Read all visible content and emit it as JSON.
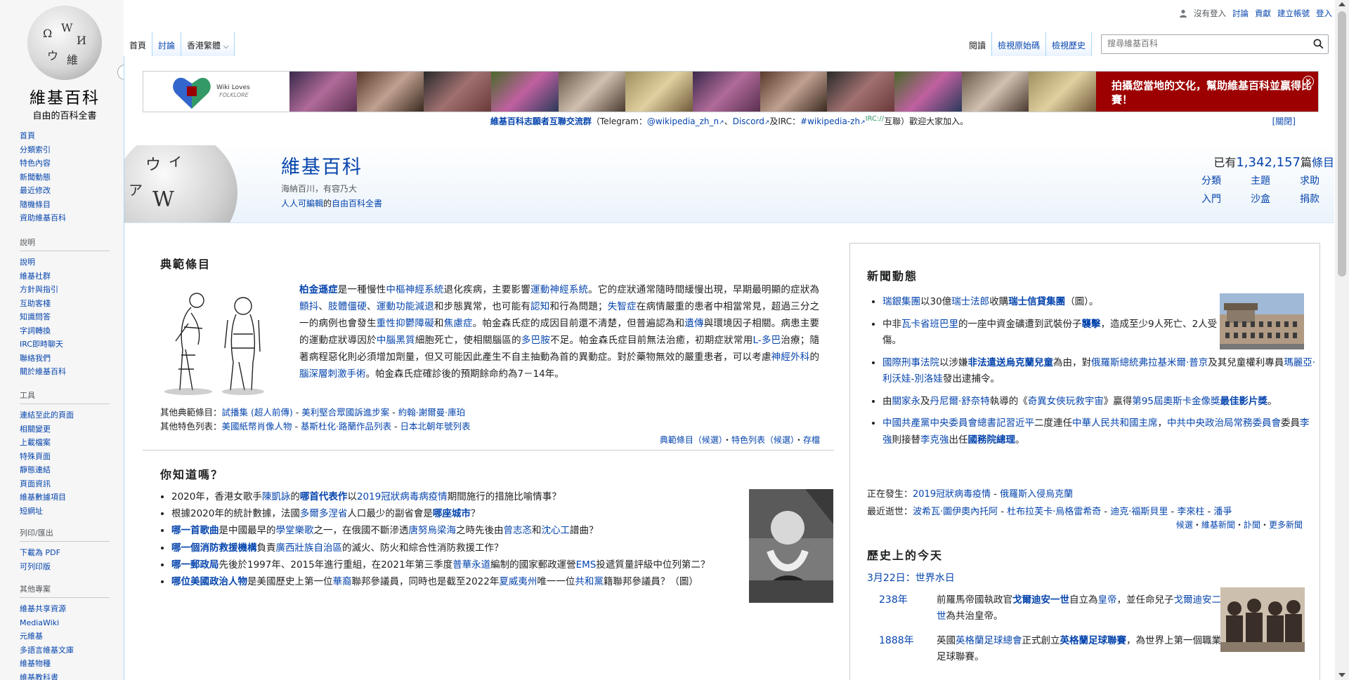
{
  "logo": {
    "wordmark": "維基百科",
    "tagline": "自由的百科全書"
  },
  "sidebar": {
    "main": [
      "首頁",
      "分類索引",
      "特色內容",
      "新聞動態",
      "最近修改",
      "隨機條目",
      "資助維基百科"
    ],
    "help_heading": "說明",
    "help": [
      "說明",
      "維基社群",
      "方針與指引",
      "互助客棧",
      "知識問答",
      "字詞轉換",
      "IRC即時聊天",
      "聯絡我們",
      "關於維基百科"
    ],
    "tools_heading": "工具",
    "tools": [
      "連結至此的頁面",
      "相關變更",
      "上載檔案",
      "特殊頁面",
      "靜態連結",
      "頁面資訊",
      "維基數據項目",
      "短網址"
    ],
    "print_heading": "列印/匯出",
    "print": [
      "下載為 PDF",
      "可列印版"
    ],
    "other_heading": "其他專案",
    "other": [
      "維基共享資源",
      "MediaWiki",
      "元維基",
      "多語言維基文庫",
      "維基物種",
      "維基教科書"
    ]
  },
  "personal": [
    "沒有登入",
    "討論",
    "貢獻",
    "建立帳號",
    "登入"
  ],
  "tabs_left": [
    "首頁",
    "討論",
    "香港繁體"
  ],
  "tabs_right": [
    "閱讀",
    "檢視原始碼",
    "檢視歷史"
  ],
  "search": {
    "placeholder": "搜尋維基百科"
  },
  "banner": {
    "wlf_line1": "Wiki Loves",
    "wlf_line2": "FOLKLORE",
    "message": "拍攝您當地的文化，幫助維基百科並贏得比賽！"
  },
  "notice": {
    "link1": "維基百科志願者互聯交流群",
    "t1": "（Telegram：",
    "link2": "@wikipedia_zh_n",
    "t2": "、",
    "link3": "Discord",
    "t3": "及IRC：",
    "link4": "#wikipedia-zh",
    "irc": "IRC://",
    "t4": "互聯）歡迎大家加入。",
    "close": "[關閉]"
  },
  "mainpage": {
    "title": "維基百科",
    "sub1": "海納百川，有容乃大",
    "sub2_link1": "人人可編輯",
    "sub2_text": "的",
    "sub2_link2": "自由百科全書",
    "count_prefix": "已有",
    "count": "1,342,157",
    "count_suffix": "篇",
    "count_link": "條目",
    "links": [
      "分類",
      "主題",
      "求助",
      "入門",
      "沙盒",
      "捐款"
    ]
  },
  "tfa": {
    "title": "典範條目",
    "text": [
      {
        "t": "柏金遜症",
        "l": 1,
        "b": 1
      },
      {
        "t": "是一種慢性"
      },
      {
        "t": "中樞神經系統",
        "l": 1
      },
      {
        "t": "退化疾病，主要影響"
      },
      {
        "t": "運動神經系統",
        "l": 1
      },
      {
        "t": "。它的症狀通常隨時間緩慢出現，早期最明顯的症狀為"
      },
      {
        "t": "顫抖",
        "l": 1
      },
      {
        "t": "、"
      },
      {
        "t": "肢體僵硬",
        "l": 1
      },
      {
        "t": "、"
      },
      {
        "t": "運動功能減退",
        "l": 1
      },
      {
        "t": "和步態異常，也可能有"
      },
      {
        "t": "認知",
        "l": 1
      },
      {
        "t": "和行為問題；"
      },
      {
        "t": "失智症",
        "l": 1
      },
      {
        "t": "在病情嚴重的患者中相當常見，超過三分之一的病例也會發生"
      },
      {
        "t": "重性抑鬱障礙",
        "l": 1
      },
      {
        "t": "和"
      },
      {
        "t": "焦慮症",
        "l": 1
      },
      {
        "t": "。帕金森氏症的成因目前還不清楚，但普遍認為和"
      },
      {
        "t": "遺傳",
        "l": 1
      },
      {
        "t": "與環境因子相關。病患主要的運動症狀導因於"
      },
      {
        "t": "中腦",
        "l": 1
      },
      {
        "t": "黑質",
        "l": 1
      },
      {
        "t": "細胞死亡，使相關腦區的"
      },
      {
        "t": "多巴胺",
        "l": 1
      },
      {
        "t": "不足。帕金森氏症目前無法治癒，初期症狀常用"
      },
      {
        "t": "L-多巴",
        "l": 1
      },
      {
        "t": "治療；隨著病程惡化則必須增加劑量，但又可能因此產生不自主抽動為首的異動症。對於藥物無效的嚴重患者，可以考慮"
      },
      {
        "t": "神經外科",
        "l": 1
      },
      {
        "t": "的"
      },
      {
        "t": "腦深層刺激手術",
        "l": 1
      },
      {
        "t": "。帕金森氏症確診後的預期餘命約為7－14年。"
      }
    ],
    "other1_label": "其他典範條目：",
    "other1": [
      "試播集 (超人前傳)",
      "美利堅合眾國訴進步案",
      "約翰·謝爾曼·庫珀"
    ],
    "other2_label": "其他特色列表：",
    "other2": [
      "美國紙幣肖像人物",
      "基斯杜化·路蘭作品列表",
      "日本北朝年號列表"
    ],
    "foot": [
      "典範條目（候選）",
      "特色列表（候選）",
      "存檔"
    ]
  },
  "dyk": {
    "title": "你知道嗎？",
    "items": [
      [
        {
          "t": "2020年，香港女歌手"
        },
        {
          "t": "陳凱詠",
          "l": 1
        },
        {
          "t": "的"
        },
        {
          "t": "哪首代表作",
          "l": 1,
          "b": 1
        },
        {
          "t": "以"
        },
        {
          "t": "2019冠狀病毒病疫情",
          "l": 1
        },
        {
          "t": "期間施行的措施比喻情事？"
        }
      ],
      [
        {
          "t": "根據2020年的統計數據，法國"
        },
        {
          "t": "多爾多涅省",
          "l": 1
        },
        {
          "t": "人口最少的副省會是"
        },
        {
          "t": "哪座城市",
          "l": 1,
          "b": 1
        },
        {
          "t": "？"
        }
      ],
      [
        {
          "t": "哪一首歌曲",
          "l": 1,
          "b": 1
        },
        {
          "t": "是中國最早的"
        },
        {
          "t": "學堂樂歌",
          "l": 1
        },
        {
          "t": "之一，在俄國不斷滲透"
        },
        {
          "t": "唐努烏梁海",
          "l": 1
        },
        {
          "t": "之時先後由"
        },
        {
          "t": "曾志忞",
          "l": 1
        },
        {
          "t": "和"
        },
        {
          "t": "沈心工",
          "l": 1
        },
        {
          "t": "譜曲？"
        }
      ],
      [
        {
          "t": "哪一個消防救援機構",
          "l": 1,
          "b": 1
        },
        {
          "t": "負責"
        },
        {
          "t": "廣西壯族自治區",
          "l": 1
        },
        {
          "t": "的滅火、防火和綜合性消防救援工作？"
        }
      ],
      [
        {
          "t": "哪一郵政局",
          "l": 1,
          "b": 1
        },
        {
          "t": "先後於1997年、2015年進行重組，在2021年第三季度"
        },
        {
          "t": "普華永道",
          "l": 1
        },
        {
          "t": "編制的國家郵政運營"
        },
        {
          "t": "EMS",
          "l": 1
        },
        {
          "t": "投遞質量評級中位列第二？"
        }
      ],
      [
        {
          "t": "哪位美國政治人物",
          "l": 1,
          "b": 1
        },
        {
          "t": "是美國歷史上第一位"
        },
        {
          "t": "華裔",
          "l": 1
        },
        {
          "t": "聯邦參議員，同時也是截至2022年"
        },
        {
          "t": "夏威夷州",
          "l": 1
        },
        {
          "t": "唯一一位"
        },
        {
          "t": "共和黨",
          "l": 1
        },
        {
          "t": "籍聯邦參議員？（圖）"
        }
      ]
    ]
  },
  "itn": {
    "title": "新聞動態",
    "items": [
      [
        {
          "t": "瑞銀集團",
          "l": 1
        },
        {
          "t": "以30億"
        },
        {
          "t": "瑞士法郎",
          "l": 1
        },
        {
          "t": "收購"
        },
        {
          "t": "瑞士信貸集團",
          "l": 1,
          "b": 1
        },
        {
          "t": "（圖）。"
        }
      ],
      [
        {
          "t": "中非"
        },
        {
          "t": "瓦卡省",
          "l": 1
        },
        {
          "t": "班巴里",
          "l": 1
        },
        {
          "t": "的一座中資金礦遭到武裝份子"
        },
        {
          "t": "襲擊",
          "l": 1,
          "b": 1
        },
        {
          "t": "，造成至少9人死亡、2人受傷。"
        }
      ],
      [
        {
          "t": "國際刑事法院",
          "l": 1
        },
        {
          "t": "以涉嫌"
        },
        {
          "t": "非法遣送烏克蘭兒童",
          "l": 1,
          "b": 1
        },
        {
          "t": "為由，對"
        },
        {
          "t": "俄羅斯總統",
          "l": 1
        },
        {
          "t": "弗拉基米爾·普京",
          "l": 1
        },
        {
          "t": "及其兒童權利專員"
        },
        {
          "t": "瑪麗亞·利沃娃-別洛娃",
          "l": 1
        },
        {
          "t": "發出逮捕令。"
        }
      ],
      [
        {
          "t": "由"
        },
        {
          "t": "關家永",
          "l": 1
        },
        {
          "t": "及"
        },
        {
          "t": "丹尼爾·舒奈特",
          "l": 1
        },
        {
          "t": "執導的《"
        },
        {
          "t": "奇異女俠玩救宇宙",
          "l": 1
        },
        {
          "t": "》贏得"
        },
        {
          "t": "第95屆奧斯卡金像獎",
          "l": 1
        },
        {
          "t": "最佳影片獎",
          "l": 1,
          "b": 1
        },
        {
          "t": "。"
        }
      ],
      [
        {
          "t": "中國共產黨中央委員會總書記",
          "l": 1
        },
        {
          "t": "習近平",
          "l": 1
        },
        {
          "t": "二度連任"
        },
        {
          "t": "中華人民共和國主席",
          "l": 1
        },
        {
          "t": "，"
        },
        {
          "t": "中共中央政治局常務委員會",
          "l": 1
        },
        {
          "t": "委員"
        },
        {
          "t": "李強",
          "l": 1
        },
        {
          "t": "則接替"
        },
        {
          "t": "李克強",
          "l": 1
        },
        {
          "t": "出任"
        },
        {
          "t": "國務院總理",
          "l": 1,
          "b": 1
        },
        {
          "t": "。"
        }
      ]
    ],
    "ongoing_label": "正在發生：",
    "ongoing": [
      "2019冠狀病毒疫情",
      "俄羅斯入侵烏克蘭"
    ],
    "recent_label": "最近逝世：",
    "recent": [
      "波希瓦·圖伊奧內托阿",
      "杜布拉芙卡·烏格雷希奇",
      "迪克·福斯貝里",
      "李來柱",
      "潘爭"
    ],
    "foot": [
      "候選",
      "維基新聞",
      "訃聞",
      "更多新聞"
    ]
  },
  "otd": {
    "title": "歷史上的今天",
    "date_link": "3月22日",
    "date_sep": "：",
    "date_event": "世界水日",
    "rows": [
      {
        "year": "238年",
        "text": [
          {
            "t": "前羅馬帝國執政官"
          },
          {
            "t": "戈爾迪安一世",
            "l": 1,
            "b": 1
          },
          {
            "t": "自立為"
          },
          {
            "t": "皇帝",
            "l": 1
          },
          {
            "t": "，並任命兒子"
          },
          {
            "t": "戈爾迪安二世",
            "l": 1
          },
          {
            "t": "為共治皇帝。"
          }
        ]
      },
      {
        "year": "1888年",
        "text": [
          {
            "t": "英國"
          },
          {
            "t": "英格蘭足球總會",
            "l": 1
          },
          {
            "t": "正式創立"
          },
          {
            "t": "英格蘭足球聯賽",
            "l": 1,
            "b": 1
          },
          {
            "t": "，為世界上第一個職業足球聯賽。"
          }
        ]
      }
    ]
  }
}
